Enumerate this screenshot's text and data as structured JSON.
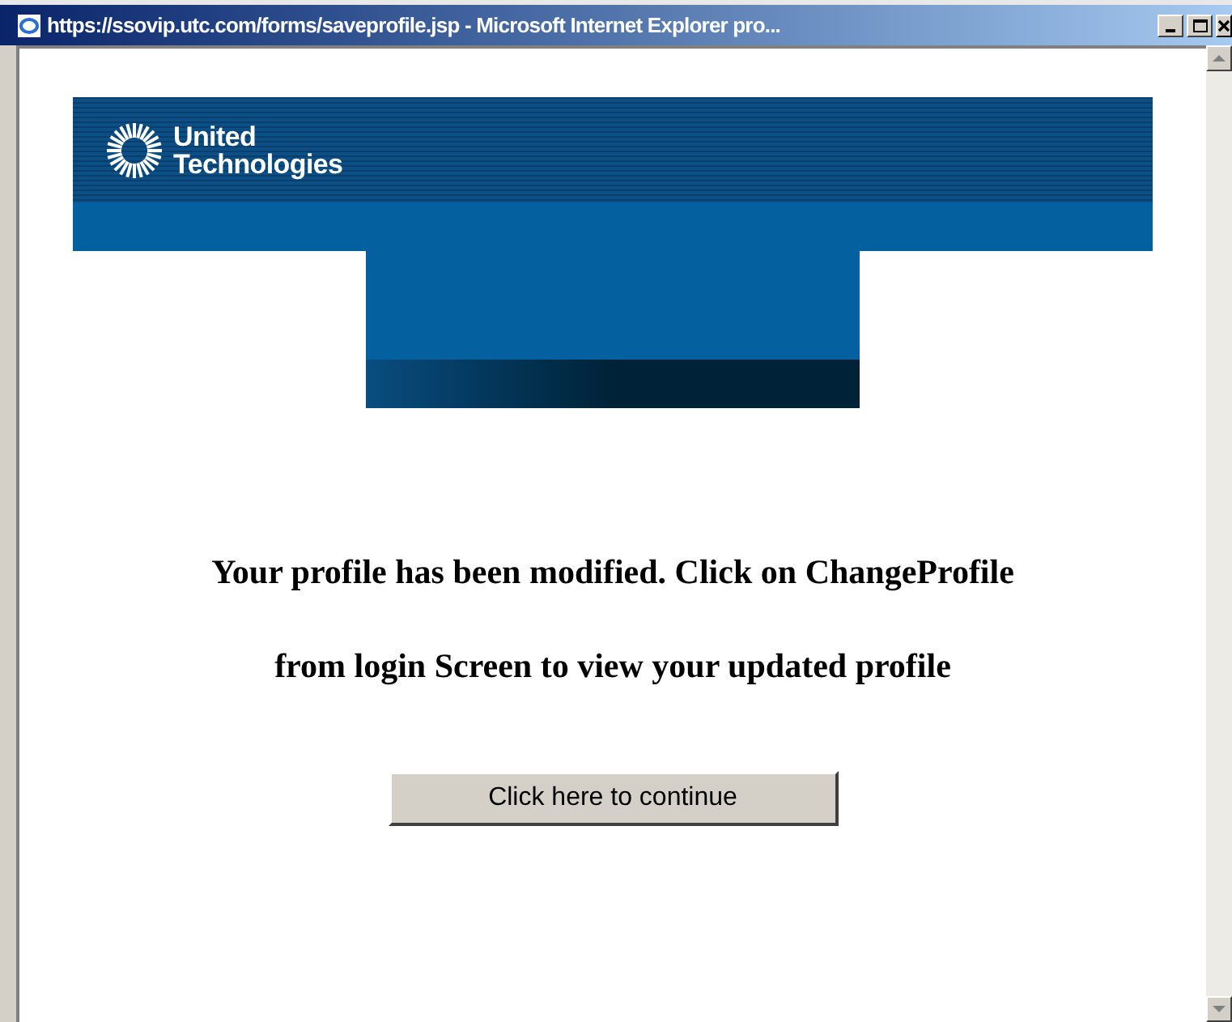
{
  "window": {
    "title": "https://ssovip.utc.com/forms/saveprofile.jsp - Microsoft Internet Explorer pro..."
  },
  "logo": {
    "line_1": "United",
    "line_2": "Technologies"
  },
  "message": {
    "lines": [
      "Your profile has been modified. Click on ChangeProfile",
      "from login Screen to view your updated profile"
    ]
  },
  "button": {
    "label": "Click here to continue"
  }
}
